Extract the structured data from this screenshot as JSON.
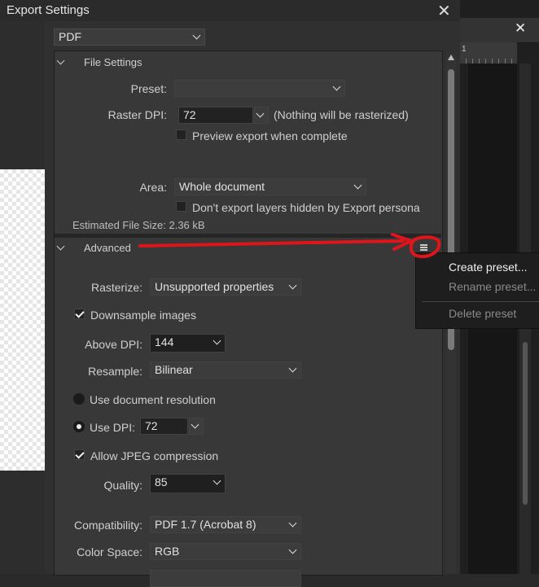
{
  "window": {
    "title": "Export Settings",
    "close_glyph": "✕",
    "tab_close_glyph": "✕"
  },
  "format": {
    "value": "PDF"
  },
  "file_settings": {
    "header": "File Settings",
    "preset_label": "Preset:",
    "preset_value": "",
    "raster_dpi_label": "Raster DPI:",
    "raster_dpi_value": "72",
    "raster_note": "(Nothing will be rasterized)",
    "preview_label": "Preview export when complete",
    "area_label": "Area:",
    "area_value": "Whole document",
    "hidden_layers_label": "Don't export layers hidden by Export persona",
    "estimated_size": "Estimated File Size: 2.36 kB"
  },
  "advanced": {
    "header": "Advanced",
    "menu_icon": "hamburger-icon",
    "rasterize_label": "Rasterize:",
    "rasterize_value": "Unsupported properties",
    "downsample_label": "Downsample images",
    "above_dpi_label": "Above DPI:",
    "above_dpi_value": "144",
    "resample_label": "Resample:",
    "resample_value": "Bilinear",
    "use_doc_res_label": "Use document resolution",
    "use_dpi_label": "Use DPI:",
    "use_dpi_value": "72",
    "jpeg_label": "Allow JPEG compression",
    "quality_label": "Quality:",
    "quality_value": "85",
    "compat_label": "Compatibility:",
    "compat_value": "PDF 1.7 (Acrobat 8)",
    "colorspace_label": "Color Space:",
    "colorspace_value": "RGB"
  },
  "context_menu": {
    "items": [
      "Create preset...",
      "Rename preset...",
      "Delete preset"
    ],
    "colors": {
      "enabled": "#f0f0f0",
      "disabled": "#8a8a8a"
    }
  },
  "background": {
    "ruler_mark": "1"
  },
  "colors": {
    "annotation": "#e0141b"
  }
}
